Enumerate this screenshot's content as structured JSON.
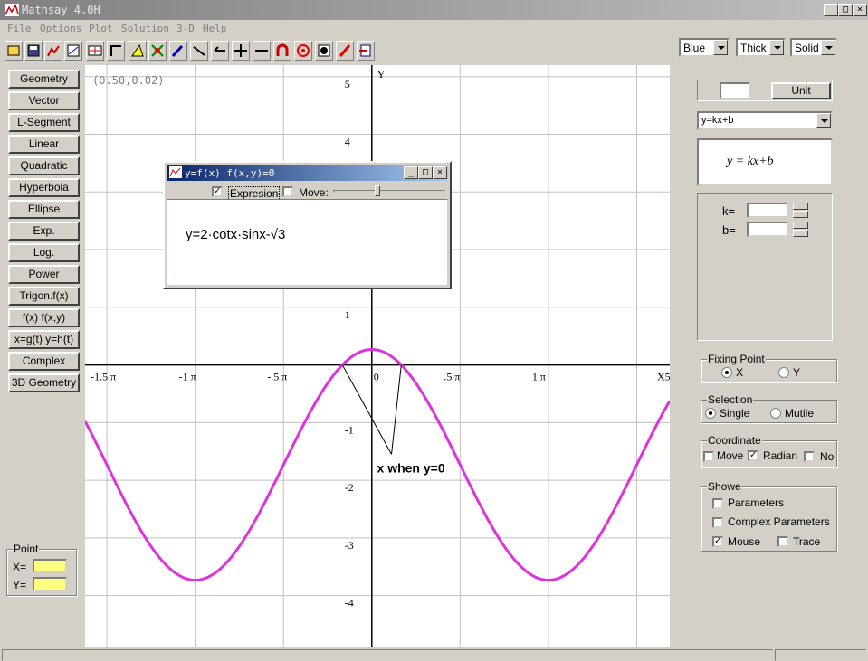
{
  "window": {
    "title": "Mathsay 4.0H",
    "minimize": "_",
    "maximize": "□",
    "close": "×"
  },
  "menu": [
    "File",
    "Options",
    "Plot",
    "Solution",
    "3-D",
    "Help"
  ],
  "toolbar_icons": [
    "new-icon",
    "save-icon",
    "chart-icon",
    "graph-icon",
    "axes-icon",
    "corner-icon",
    "triangle-icon",
    "cross-icon",
    "pen-icon",
    "line-icon",
    "arrow-left-icon",
    "plus-icon",
    "minus-icon",
    "magnet-icon",
    "target-icon",
    "contrast-icon",
    "pencil-icon",
    "exit-icon"
  ],
  "style_selects": {
    "color": "Blue",
    "width": "Thick",
    "line": "Solid"
  },
  "left_buttons": [
    "Geometry",
    "Vector",
    "L-Segment",
    "Linear",
    "Quadratic",
    "Hyperbola",
    "Ellipse",
    "Exp.",
    "Log.",
    "Power",
    "Trigon.f(x)",
    "f(x)  f(x,y)",
    "x=g(t) y=h(t)",
    "Complex",
    "3D Geometry"
  ],
  "point": {
    "legend": "Point",
    "x_label": "X=",
    "y_label": "Y=",
    "x_value": "",
    "y_value": ""
  },
  "plot": {
    "coord_readout": "(0.50,0.02)",
    "y_axis_label": "Y",
    "x_ticks": [
      "-1.5 π",
      "-1 π",
      "-.5 π",
      "0",
      ".5 π",
      "1 π",
      "X5"
    ],
    "y_ticks": [
      "5",
      "4",
      "1",
      "-1",
      "-2",
      "-3",
      "-4"
    ],
    "annotation": "x when y=0",
    "curve_color": "#dd33dd"
  },
  "chart_data": {
    "type": "line",
    "title": "",
    "function": "y=2·cotx·sinx-√3",
    "series": [
      {
        "name": "",
        "expression": "2*cos(x)-sqrt(3)"
      }
    ],
    "xlim": [
      -5.1,
      5.3
    ],
    "ylim": [
      -4.9,
      5.2
    ],
    "x_tick_values": [
      -4.712,
      -3.1416,
      -1.5708,
      0,
      1.5708,
      3.1416
    ],
    "y_tick_values": [
      5,
      4,
      1,
      -1,
      -2,
      -3,
      -4
    ],
    "roots": [
      -0.5236,
      0.5236
    ],
    "grid": true
  },
  "subwindow": {
    "title": "y=f(x)  f(x,y)=0",
    "expression_checkbox": "Expresion",
    "expression_checked": true,
    "move_checkbox": "Move:",
    "move_checked": false,
    "formula": "y=2·cotx·sinx-√3"
  },
  "right": {
    "unit_value": "",
    "unit_button": "Unit",
    "type_select": "y=kx+b",
    "formula": "y = kx+b",
    "params": [
      {
        "label": "k=",
        "value": ""
      },
      {
        "label": "b=",
        "value": ""
      }
    ],
    "fixing_point": {
      "legend": "Fixing Point",
      "options": [
        "X",
        "Y"
      ],
      "selected": "X"
    },
    "selection": {
      "legend": "Selection",
      "options": [
        "Single",
        "Mutile"
      ],
      "selected": "Single"
    },
    "coordinate": {
      "legend": "Coordinate",
      "move": "Move",
      "radian": "Radian",
      "no": "No",
      "move_checked": false,
      "radian_checked": true,
      "no_checked": false
    },
    "showe": {
      "legend": "Showe",
      "parameters": "Parameters",
      "complex_parameters": "Complex Parameters",
      "mouse": "Mouse",
      "trace": "Trace",
      "mouse_checked": true
    }
  }
}
